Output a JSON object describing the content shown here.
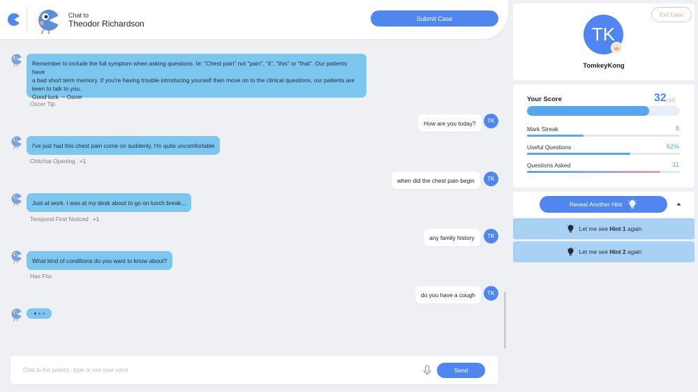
{
  "header": {
    "chat_to_label": "Chat to",
    "patient_name": "Theodor Richardson",
    "submit_label": "Submit Case"
  },
  "messages": [
    {
      "from": "bot",
      "lines": [
        "Remember to include the full symptom when asking questions. Ie: \"Chest pain\" not \"pain\", \"it\", \"this\" or \"that\". Our patients have",
        "a bad short term memory. If you're having trouble introducing yourself then move on to the clinical questions, our patients are",
        "keen to talk to you.",
        "Good luck. ~ Oscer"
      ],
      "caption": "Oscer Tip",
      "points": ""
    },
    {
      "from": "user",
      "text": "How are you today?"
    },
    {
      "from": "bot",
      "text": "I've just had this chest pain come on suddenly, I'm quite uncomfortable",
      "caption": "Chitchat Opening",
      "points": "+1"
    },
    {
      "from": "user",
      "text": "when did the chest pain begin"
    },
    {
      "from": "bot",
      "text": "Just at work. I was at my desk about to go on lunch break...",
      "caption": "Temporal First Noticed",
      "points": "+1"
    },
    {
      "from": "user",
      "text": "any family history"
    },
    {
      "from": "bot",
      "text": "What kind of conditions do you want to know about?",
      "caption": "Has Fhx",
      "points": ""
    },
    {
      "from": "user",
      "text": "do you have a cough"
    }
  ],
  "user_initials": "TK",
  "input": {
    "placeholder": "Chat to the patient - type or use your voice",
    "value": "",
    "send_label": "Send"
  },
  "profile": {
    "exit_label": "Exit Case",
    "initials": "TK",
    "username": "TomkeyKong"
  },
  "score": {
    "title": "Your Score",
    "value": "32",
    "max": "/40",
    "progress": 0.8,
    "stats": [
      {
        "label": "Mark Streak",
        "value": "8",
        "progress": 0.37,
        "color": "#5aa8e8"
      },
      {
        "label": "Useful Questions",
        "value": "62%",
        "progress": 0.678,
        "color": "#5aa8e8"
      },
      {
        "label": "Questions Asked",
        "value": "31",
        "progress": 0.87,
        "color": "gradient"
      }
    ]
  },
  "hints": {
    "reveal_label": "Reveal Another Hint",
    "items": [
      {
        "prefix": "Let me see",
        "bold": "Hint 1",
        "suffix": "again"
      },
      {
        "prefix": "Let me see",
        "bold": "Hint 2",
        "suffix": "again"
      }
    ]
  },
  "colors": {
    "accent": "#4f86ef",
    "bot_bubble": "#7dc6ef",
    "hint_row": "#a9d1f3",
    "exit": "#f0a890"
  }
}
